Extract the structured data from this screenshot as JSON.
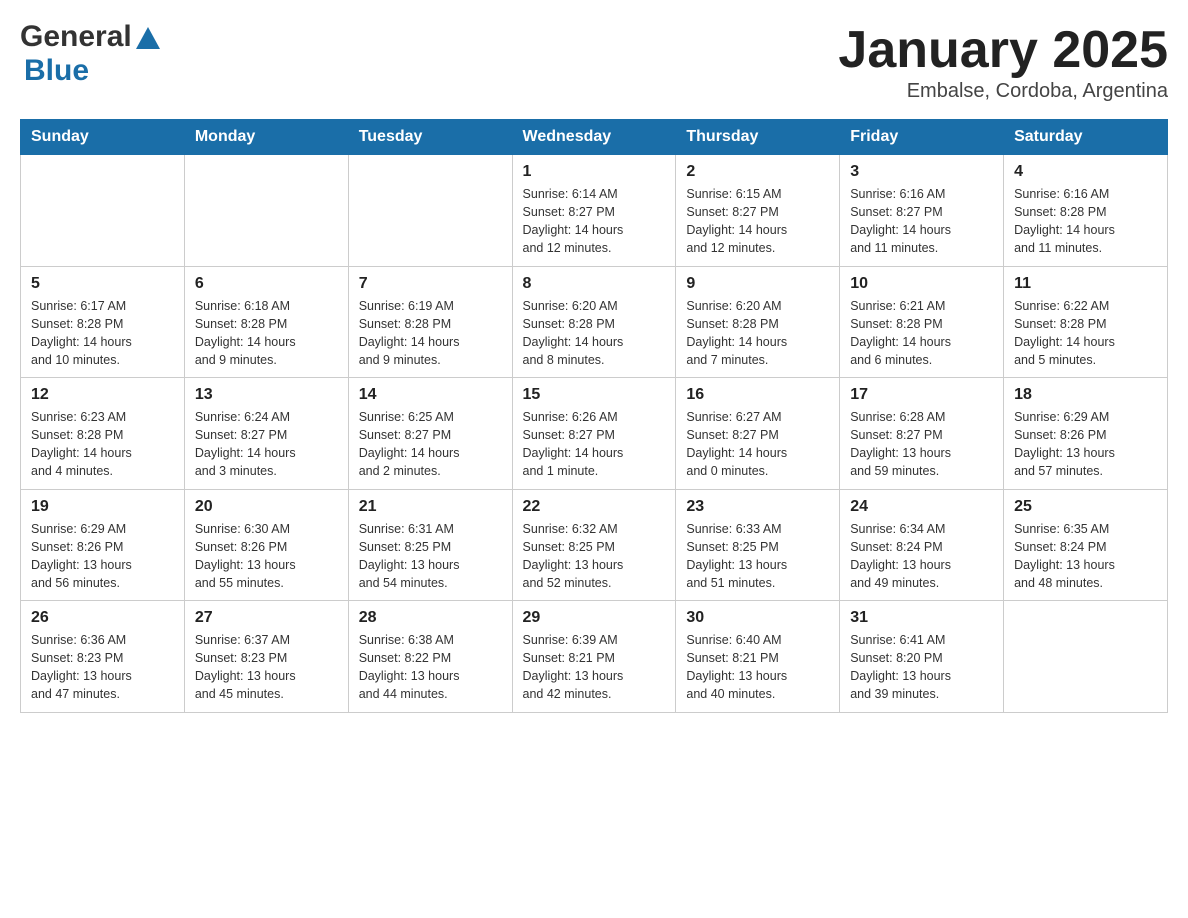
{
  "header": {
    "title": "January 2025",
    "location": "Embalse, Cordoba, Argentina"
  },
  "days_of_week": [
    "Sunday",
    "Monday",
    "Tuesday",
    "Wednesday",
    "Thursday",
    "Friday",
    "Saturday"
  ],
  "weeks": [
    [
      {
        "day": "",
        "info": ""
      },
      {
        "day": "",
        "info": ""
      },
      {
        "day": "",
        "info": ""
      },
      {
        "day": "1",
        "info": "Sunrise: 6:14 AM\nSunset: 8:27 PM\nDaylight: 14 hours\nand 12 minutes."
      },
      {
        "day": "2",
        "info": "Sunrise: 6:15 AM\nSunset: 8:27 PM\nDaylight: 14 hours\nand 12 minutes."
      },
      {
        "day": "3",
        "info": "Sunrise: 6:16 AM\nSunset: 8:27 PM\nDaylight: 14 hours\nand 11 minutes."
      },
      {
        "day": "4",
        "info": "Sunrise: 6:16 AM\nSunset: 8:28 PM\nDaylight: 14 hours\nand 11 minutes."
      }
    ],
    [
      {
        "day": "5",
        "info": "Sunrise: 6:17 AM\nSunset: 8:28 PM\nDaylight: 14 hours\nand 10 minutes."
      },
      {
        "day": "6",
        "info": "Sunrise: 6:18 AM\nSunset: 8:28 PM\nDaylight: 14 hours\nand 9 minutes."
      },
      {
        "day": "7",
        "info": "Sunrise: 6:19 AM\nSunset: 8:28 PM\nDaylight: 14 hours\nand 9 minutes."
      },
      {
        "day": "8",
        "info": "Sunrise: 6:20 AM\nSunset: 8:28 PM\nDaylight: 14 hours\nand 8 minutes."
      },
      {
        "day": "9",
        "info": "Sunrise: 6:20 AM\nSunset: 8:28 PM\nDaylight: 14 hours\nand 7 minutes."
      },
      {
        "day": "10",
        "info": "Sunrise: 6:21 AM\nSunset: 8:28 PM\nDaylight: 14 hours\nand 6 minutes."
      },
      {
        "day": "11",
        "info": "Sunrise: 6:22 AM\nSunset: 8:28 PM\nDaylight: 14 hours\nand 5 minutes."
      }
    ],
    [
      {
        "day": "12",
        "info": "Sunrise: 6:23 AM\nSunset: 8:28 PM\nDaylight: 14 hours\nand 4 minutes."
      },
      {
        "day": "13",
        "info": "Sunrise: 6:24 AM\nSunset: 8:27 PM\nDaylight: 14 hours\nand 3 minutes."
      },
      {
        "day": "14",
        "info": "Sunrise: 6:25 AM\nSunset: 8:27 PM\nDaylight: 14 hours\nand 2 minutes."
      },
      {
        "day": "15",
        "info": "Sunrise: 6:26 AM\nSunset: 8:27 PM\nDaylight: 14 hours\nand 1 minute."
      },
      {
        "day": "16",
        "info": "Sunrise: 6:27 AM\nSunset: 8:27 PM\nDaylight: 14 hours\nand 0 minutes."
      },
      {
        "day": "17",
        "info": "Sunrise: 6:28 AM\nSunset: 8:27 PM\nDaylight: 13 hours\nand 59 minutes."
      },
      {
        "day": "18",
        "info": "Sunrise: 6:29 AM\nSunset: 8:26 PM\nDaylight: 13 hours\nand 57 minutes."
      }
    ],
    [
      {
        "day": "19",
        "info": "Sunrise: 6:29 AM\nSunset: 8:26 PM\nDaylight: 13 hours\nand 56 minutes."
      },
      {
        "day": "20",
        "info": "Sunrise: 6:30 AM\nSunset: 8:26 PM\nDaylight: 13 hours\nand 55 minutes."
      },
      {
        "day": "21",
        "info": "Sunrise: 6:31 AM\nSunset: 8:25 PM\nDaylight: 13 hours\nand 54 minutes."
      },
      {
        "day": "22",
        "info": "Sunrise: 6:32 AM\nSunset: 8:25 PM\nDaylight: 13 hours\nand 52 minutes."
      },
      {
        "day": "23",
        "info": "Sunrise: 6:33 AM\nSunset: 8:25 PM\nDaylight: 13 hours\nand 51 minutes."
      },
      {
        "day": "24",
        "info": "Sunrise: 6:34 AM\nSunset: 8:24 PM\nDaylight: 13 hours\nand 49 minutes."
      },
      {
        "day": "25",
        "info": "Sunrise: 6:35 AM\nSunset: 8:24 PM\nDaylight: 13 hours\nand 48 minutes."
      }
    ],
    [
      {
        "day": "26",
        "info": "Sunrise: 6:36 AM\nSunset: 8:23 PM\nDaylight: 13 hours\nand 47 minutes."
      },
      {
        "day": "27",
        "info": "Sunrise: 6:37 AM\nSunset: 8:23 PM\nDaylight: 13 hours\nand 45 minutes."
      },
      {
        "day": "28",
        "info": "Sunrise: 6:38 AM\nSunset: 8:22 PM\nDaylight: 13 hours\nand 44 minutes."
      },
      {
        "day": "29",
        "info": "Sunrise: 6:39 AM\nSunset: 8:21 PM\nDaylight: 13 hours\nand 42 minutes."
      },
      {
        "day": "30",
        "info": "Sunrise: 6:40 AM\nSunset: 8:21 PM\nDaylight: 13 hours\nand 40 minutes."
      },
      {
        "day": "31",
        "info": "Sunrise: 6:41 AM\nSunset: 8:20 PM\nDaylight: 13 hours\nand 39 minutes."
      },
      {
        "day": "",
        "info": ""
      }
    ]
  ]
}
